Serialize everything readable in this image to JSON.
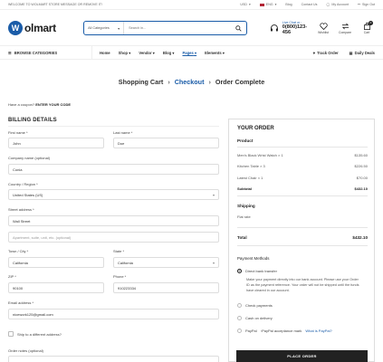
{
  "topbar": {
    "welcome": "WELCOME TO WOLMART STORE MESSAGE OR REMOVE IT!",
    "currency": "USD",
    "language": "ENG",
    "blog": "Blog",
    "contact": "Contact Us",
    "account": "My Account",
    "signout": "Sign Out"
  },
  "header": {
    "logo": "olmart",
    "category": "All Categories",
    "search_placeholder": "Search in...",
    "live_chat": "Live Chat or :",
    "phone": "0(800)123-456",
    "wishlist": "Wishlist",
    "compare": "Compare",
    "cart": "Cart",
    "cart_count": "0"
  },
  "nav": {
    "browse": "BROWSE CATEGORIES",
    "items": [
      "Home",
      "Shop",
      "Vendor",
      "Blog",
      "Pages",
      "Elements"
    ],
    "track": "Track Order",
    "deals": "Daily Deals"
  },
  "steps": {
    "cart": "Shopping Cart",
    "checkout": "Checkout",
    "complete": "Order Complete"
  },
  "coupon": {
    "text": "Have a coupon?",
    "link": "ENTER YOUR CODE"
  },
  "billing": {
    "title": "BILLING DETAILS",
    "first_name_label": "First name *",
    "first_name": "John",
    "last_name_label": "Last name *",
    "last_name": "Doe",
    "company_label": "Company name (optional)",
    "company": "Conia",
    "country_label": "Country / Region *",
    "country": "United States (US)",
    "street_label": "Street address *",
    "street": "Wall Street",
    "apartment_placeholder": "Apartment, suite, unit, etc. (optional)",
    "city_label": "Town / City *",
    "city": "California",
    "state_label": "State *",
    "state": "California",
    "zip_label": "ZIP *",
    "zip": "90100",
    "phone_label": "Phone *",
    "phone": "910223334",
    "email_label": "Email address *",
    "email": "nicework125@gmail.com",
    "ship_different": "Ship to a different address?",
    "notes_label": "Order notes (optional)"
  },
  "order": {
    "title": "YOUR ORDER",
    "product_header": "Product",
    "items": [
      {
        "name": "Men's Black Wrist Watch",
        "qty": "× 1",
        "price": "$135.60"
      },
      {
        "name": "Kitchen Table",
        "qty": "× 3",
        "price": "$226.50"
      },
      {
        "name": "Latest Chair",
        "qty": "× 1",
        "price": "$70.00"
      }
    ],
    "subtotal_label": "Subtotal",
    "subtotal": "$432.10",
    "shipping_label": "Shipping",
    "shipping_value": "Flat rate",
    "total_label": "Total",
    "total": "$432.10",
    "payment_title": "Payment Methods",
    "payments": {
      "bank": "Direct bank transfer",
      "bank_desc": "Make your payment directly into our bank account. Please use your Order ID as the payment reference. Your order will not be shipped until the funds have cleared in our account.",
      "check": "Check payments",
      "cod": "Cash on delivery",
      "paypal": "PayPal",
      "paypal_img_alt": "PayPal acceptance mark",
      "paypal_link": "What is PayPal?"
    },
    "place_order": "PLACE ORDER"
  }
}
